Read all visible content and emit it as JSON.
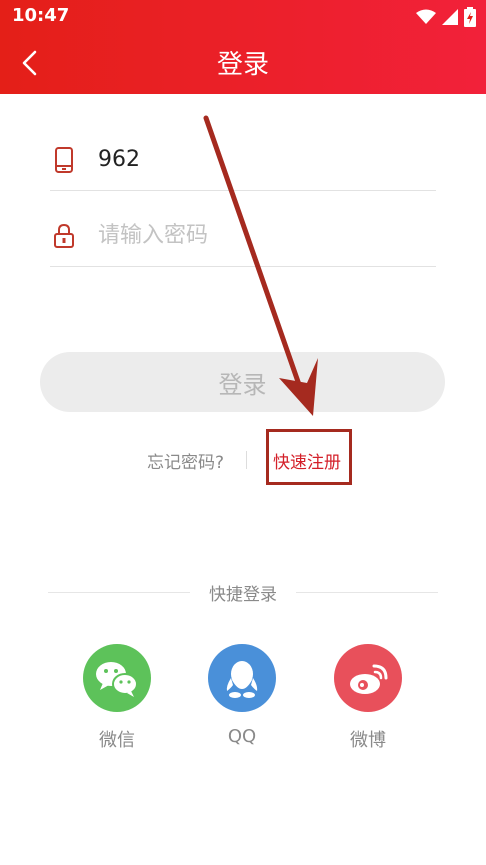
{
  "status_bar": {
    "time": "10:47"
  },
  "header": {
    "title": "登录"
  },
  "form": {
    "phone_value": "962",
    "password_placeholder": "请输入密码",
    "login_label": "登录"
  },
  "links": {
    "forgot": "忘记密码?",
    "register": "快速注册"
  },
  "quick_login": {
    "label": "快捷登录",
    "items": [
      {
        "label": "微信",
        "icon": "wechat-icon",
        "color": "#5dc25a"
      },
      {
        "label": "QQ",
        "icon": "qq-icon",
        "color": "#4a90d9"
      },
      {
        "label": "微博",
        "icon": "weibo-icon",
        "color": "#e8505b"
      }
    ]
  },
  "colors": {
    "header_start": "#e41f18",
    "header_end": "#f2213a",
    "accent": "#d4202a",
    "annotation": "#a52a1f"
  }
}
